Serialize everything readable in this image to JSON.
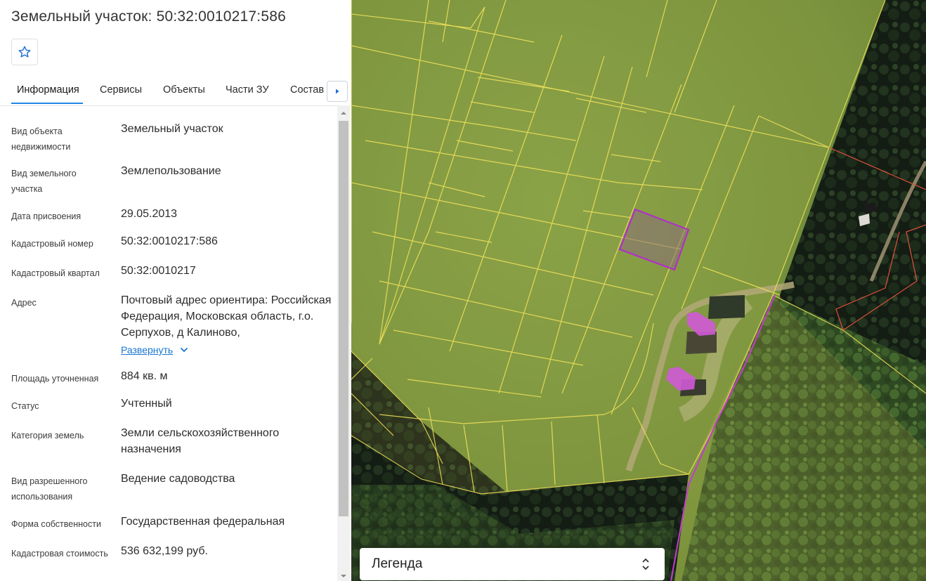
{
  "header": {
    "title": "Земельный участок: 50:32:0010217:586"
  },
  "tabs": [
    {
      "label": "Информация",
      "active": true
    },
    {
      "label": "Сервисы",
      "active": false
    },
    {
      "label": "Объекты",
      "active": false
    },
    {
      "label": "Части ЗУ",
      "active": false
    },
    {
      "label": "Состав",
      "active": false
    }
  ],
  "info": {
    "object_type_label": "Вид объекта недвижимости",
    "object_type_value": "Земельный участок",
    "land_kind_label": "Вид земельного участка",
    "land_kind_value": "Землепользование",
    "date_label": "Дата присвоения",
    "date_value": "29.05.2013",
    "cad_number_label": "Кадастровый номер",
    "cad_number_value": "50:32:0010217:586",
    "quarter_label": "Кадастровый квартал",
    "quarter_value": "50:32:0010217",
    "address_label": "Адрес",
    "address_value": "Почтовый адрес ориентира: Российская Федерация, Московская область, г.о. Серпухов, д Калиново,",
    "address_expand": "Развернуть",
    "area_label": "Площадь уточненная",
    "area_value": "884 кв. м",
    "status_label": "Статус",
    "status_value": "Учтенный",
    "category_label": "Категория земель",
    "category_value": "Земли сельскохозяйственного назначения",
    "permitted_use_label": "Вид разрешенного использования",
    "permitted_use_value": "Ведение садоводства",
    "ownership_label": "Форма собственности",
    "ownership_value": "Государственная федеральная",
    "cost_label": "Кадастровая стоимость",
    "cost_value": "536 632,199 руб."
  },
  "map": {
    "legend_label": "Легенда",
    "colors": {
      "parcel_border": "#f3e45a",
      "selected_parcel": "#b12fc7",
      "building": "#d05ad6",
      "boundary_red": "#e0523a"
    }
  }
}
